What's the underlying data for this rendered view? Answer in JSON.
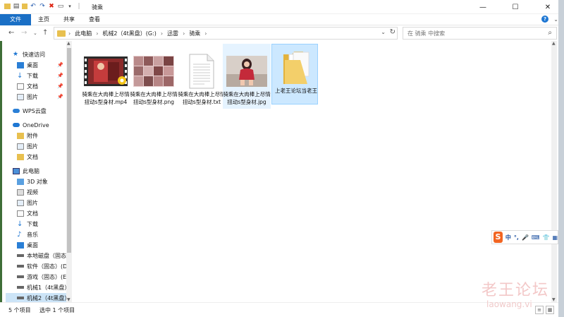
{
  "window": {
    "title": "骑乘",
    "controls": {
      "minimize": "—",
      "maximize": "☐",
      "close": "✕"
    }
  },
  "ribbon": {
    "tabs": [
      {
        "label": "文件"
      },
      {
        "label": "主页"
      },
      {
        "label": "共享"
      },
      {
        "label": "查看"
      }
    ],
    "help_label": "?"
  },
  "address": {
    "crumbs": [
      "此电脑",
      "机械2（4t黑盘）(G:)",
      "迅雷",
      "骑乘"
    ]
  },
  "search": {
    "placeholder": "在 骑乘 中搜索"
  },
  "sidebar": {
    "quick_access": "快速访问",
    "quick_items": [
      "桌面",
      "下载",
      "文档",
      "图片"
    ],
    "wps": "WPS云盘",
    "onedrive": "OneDrive",
    "onedrive_items": [
      "附件",
      "图片",
      "文档"
    ],
    "this_pc": "此电脑",
    "pc_items": [
      "3D 对象",
      "视频",
      "图片",
      "文档",
      "下载",
      "音乐",
      "桌面"
    ],
    "drives": [
      "本地磁盘（固态",
      "软件（固态）(D",
      "游戏（固态）(E",
      "机械1（4t黑盘）",
      "机械2（4t黑盘）"
    ]
  },
  "files": [
    {
      "name": "骑乘在大肉棒上尽情扭动s型身材.mp4",
      "type": "video"
    },
    {
      "name": "骑乘在大肉棒上尽情扭动s型身材.png",
      "type": "image-collage"
    },
    {
      "name": "骑乘在大肉棒上尽情扭动s型身材.txt",
      "type": "text"
    },
    {
      "name": "骑乘在大肉棒上尽情扭动s型身材.jpg",
      "type": "image-photo"
    },
    {
      "name": "上老王论坛当老王",
      "type": "folder"
    }
  ],
  "status": {
    "count": "5 个项目",
    "selected": "选中 1 个项目"
  },
  "ime": {
    "items": [
      "中",
      "°,",
      "🎤",
      "⌨",
      "👕",
      "▦"
    ]
  },
  "watermark": {
    "text": "老王论坛",
    "url": "laowang.vi"
  },
  "colors": {
    "accent": "#1a6fc5",
    "selection": "#cce8ff",
    "folder": "#e8c04f"
  }
}
